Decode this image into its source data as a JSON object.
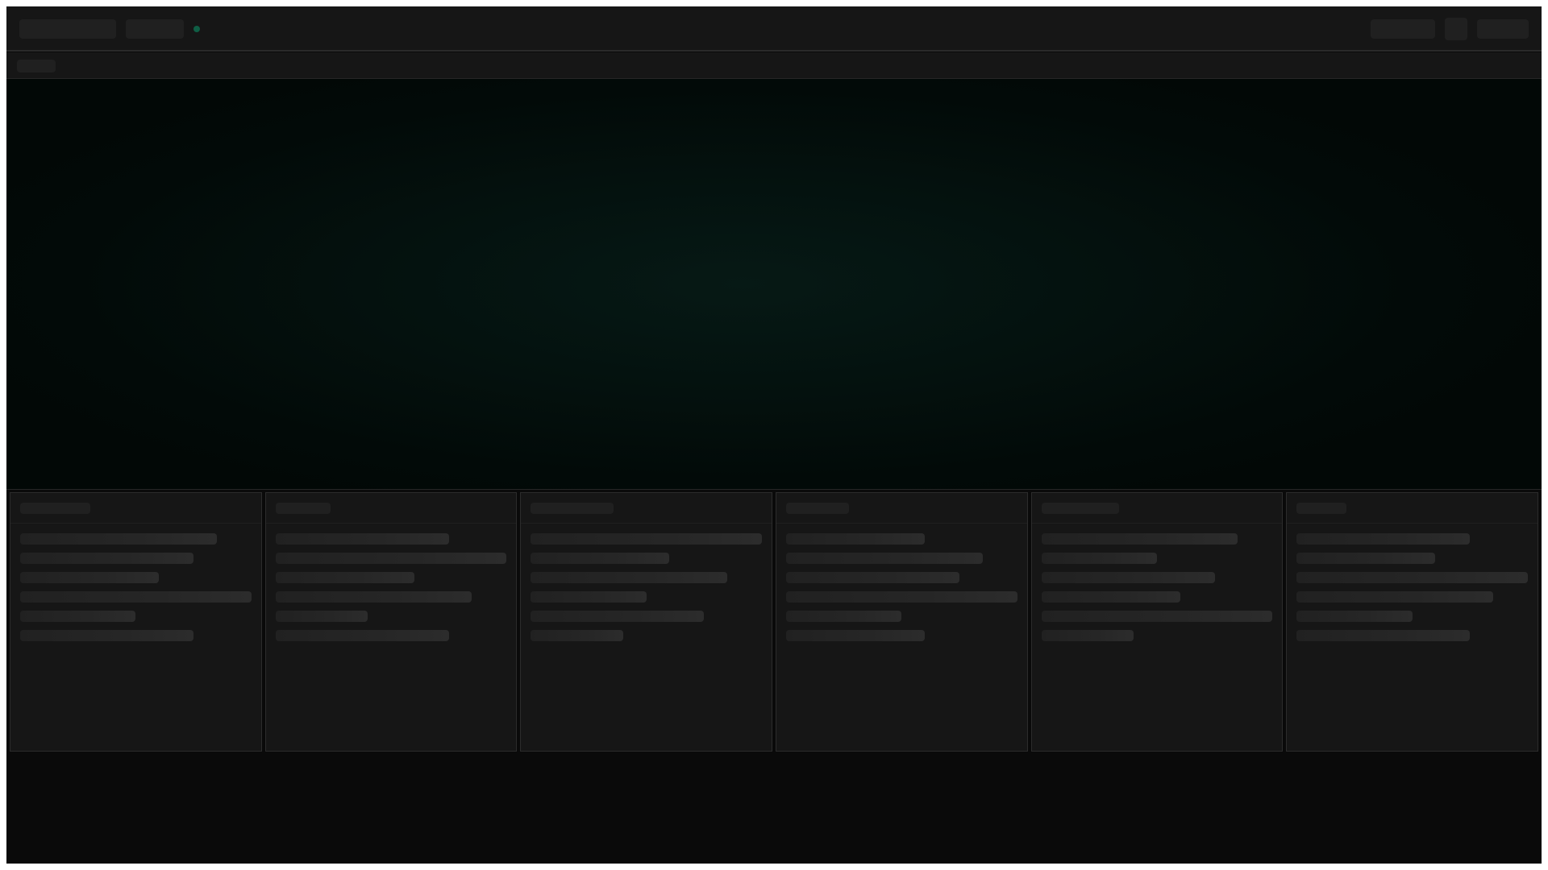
{
  "state": "loading",
  "colors": {
    "status_dot": "#0f5e45",
    "background": "#0a0a0a",
    "surface": "#161616",
    "skeleton": "#202020"
  },
  "panels": [
    {
      "id": "panel-1"
    },
    {
      "id": "panel-2"
    },
    {
      "id": "panel-3"
    },
    {
      "id": "panel-4"
    },
    {
      "id": "panel-5"
    },
    {
      "id": "panel-6"
    }
  ]
}
